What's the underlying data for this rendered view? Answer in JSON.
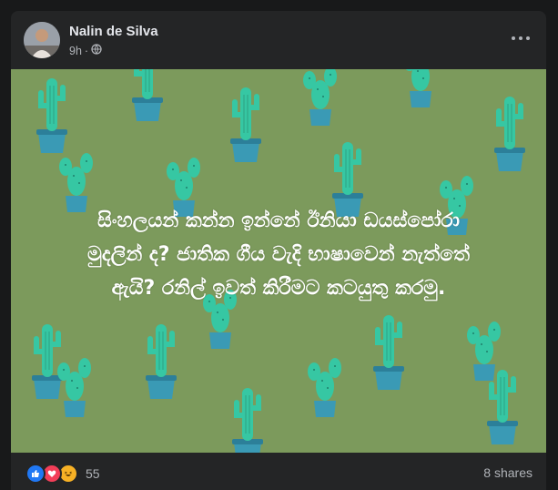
{
  "post": {
    "author": "Nalin de Silva",
    "time": "9h",
    "privacy_icon": "globe-icon",
    "more_icon": "more-options-icon",
    "background_color": "#7c9a5c",
    "background_pattern": "cactus",
    "text_lines": [
      "සිංහලයන් කන්න ඉන්නේ ඊනියා ඩයස්පෝරා",
      "මුදලින් ද? ජාතික ගීය වැදි භාෂාවෙන් නැත්තේ",
      "ඇයි? රනිල් ඉවත් කිරීමට කටයුතු කරමු."
    ]
  },
  "footer": {
    "reaction_icons": [
      "like-icon",
      "love-icon",
      "haha-icon"
    ],
    "reaction_count": "55",
    "shares": "8 shares"
  },
  "colors": {
    "page_bg": "#18191a",
    "card_bg": "#242526",
    "primary_text": "#e4e6eb",
    "secondary_text": "#b0b3b8"
  }
}
